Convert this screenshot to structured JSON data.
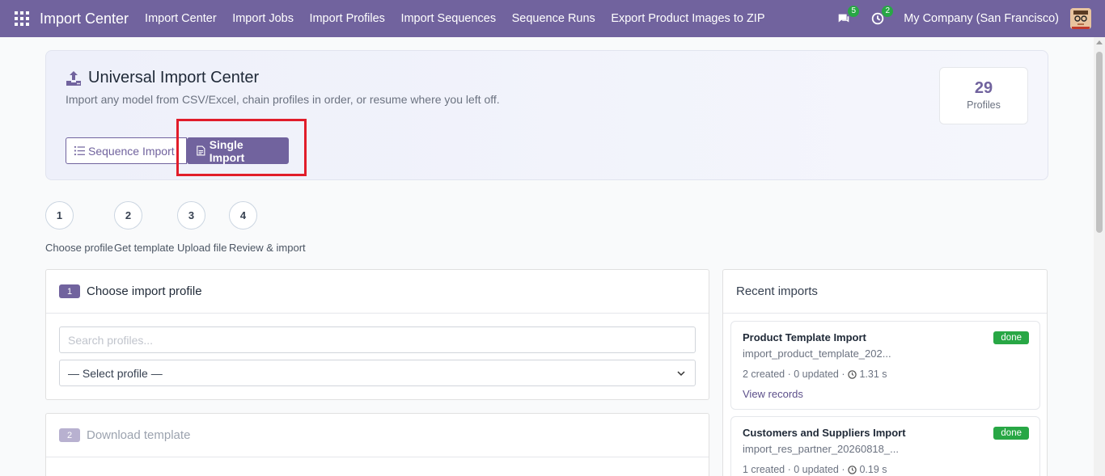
{
  "navbar": {
    "brand": "Import Center",
    "items": [
      "Import Center",
      "Import Jobs",
      "Import Profiles",
      "Import Sequences",
      "Sequence Runs",
      "Export Product Images to ZIP"
    ],
    "messages_count": "5",
    "activities_count": "2",
    "company": "My Company (San Francisco)"
  },
  "hero": {
    "title": "Universal Import Center",
    "subtitle": "Import any model from CSV/Excel, chain profiles in order, or resume where you left off.",
    "btn_sequence": "Sequence Import",
    "btn_single": "Single Import",
    "stat_value": "29",
    "stat_label": "Profiles"
  },
  "steps": [
    {
      "num": "1",
      "label": "Choose profile"
    },
    {
      "num": "2",
      "label": "Get template"
    },
    {
      "num": "3",
      "label": "Upload file"
    },
    {
      "num": "4",
      "label": "Review & import"
    }
  ],
  "profile_panel": {
    "step": "1",
    "title": "Choose import profile",
    "search_placeholder": "Search profiles...",
    "select_value": "— Select profile —"
  },
  "template_panel": {
    "step": "2",
    "title": "Download template"
  },
  "recent": {
    "title": "Recent imports",
    "items": [
      {
        "name": "Product Template Import",
        "file": "import_product_template_202...",
        "created": "2 created",
        "updated": "0 updated",
        "duration": "1.31 s",
        "status": "done",
        "link": "View records"
      },
      {
        "name": "Customers and Suppliers Import",
        "file": "import_res_partner_20260818_...",
        "created": "1 created",
        "updated": "0 updated",
        "duration": "0.19 s",
        "status": "done"
      }
    ]
  },
  "colors": {
    "brand": "#71639e",
    "success": "#28a745",
    "highlight": "#e11d2a"
  }
}
